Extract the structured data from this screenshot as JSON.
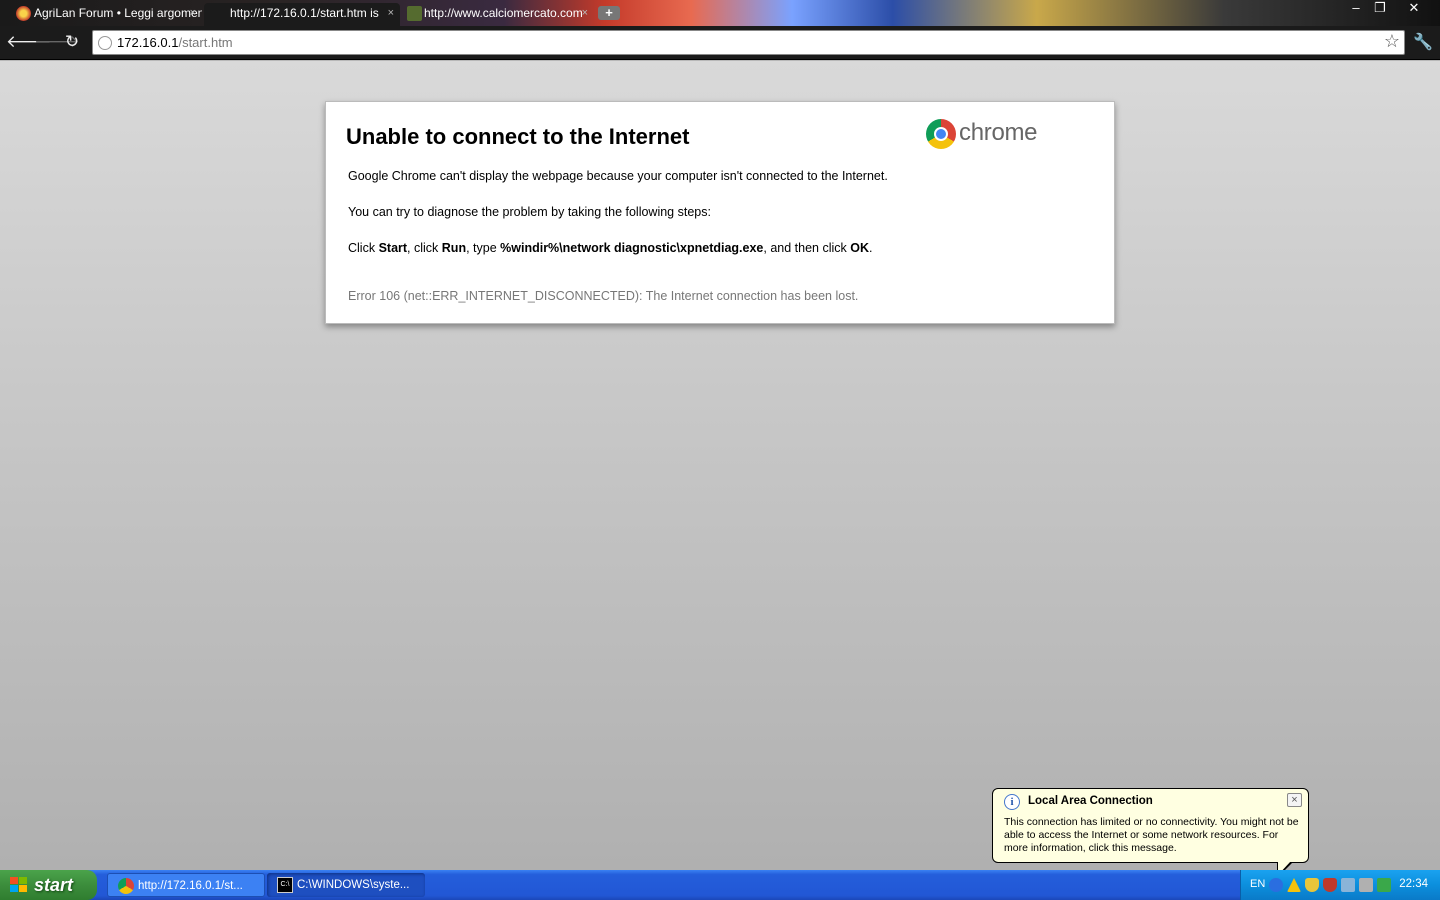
{
  "tabs": [
    {
      "title": "AgriLan Forum • Leggi argomento",
      "active": false
    },
    {
      "title": "http://172.16.0.1/start.htm is",
      "active": true
    },
    {
      "title": "http://www.calciomercato.com",
      "active": false
    }
  ],
  "tab_close_glyph": "×",
  "new_tab_glyph": "+",
  "window_controls": {
    "minimize": "–",
    "restore": "❐",
    "close": "✕"
  },
  "toolbar": {
    "back_glyph": "🡐",
    "forward_glyph": "🡒",
    "reload_glyph": "↻",
    "url_host": "172.16.0.1",
    "url_path": "/start.htm",
    "star_glyph": "☆",
    "wrench_glyph": "🔧"
  },
  "error_page": {
    "title": "Unable to connect to the Internet",
    "logo_word": "chrome",
    "line1": "Google Chrome can't display the webpage because your computer isn't connected to the Internet.",
    "line2": "You can try to diagnose the problem by taking the following steps:",
    "step": {
      "p1": "Click ",
      "b1": "Start",
      "p2": ", click ",
      "b2": "Run",
      "p3": ", type ",
      "b3": "%windir%\\network diagnostic\\xpnetdiag.exe",
      "p4": ", and then click ",
      "b4": "OK",
      "p5": "."
    },
    "error_code": "Error 106 (net::ERR_INTERNET_DISCONNECTED): The Internet connection has been lost."
  },
  "balloon": {
    "icon_glyph": "i",
    "title": "Local Area Connection",
    "close_glyph": "×",
    "text": "This connection has limited or no connectivity. You might not be able to access the Internet or some network resources. For more information, click this message."
  },
  "taskbar": {
    "start_label": "start",
    "tasks": [
      {
        "label": "http://172.16.0.1/st..."
      },
      {
        "label": "C:\\WINDOWS\\syste..."
      }
    ],
    "cmd_icon_text": "C:\\",
    "language": "EN",
    "clock": "22:34"
  }
}
